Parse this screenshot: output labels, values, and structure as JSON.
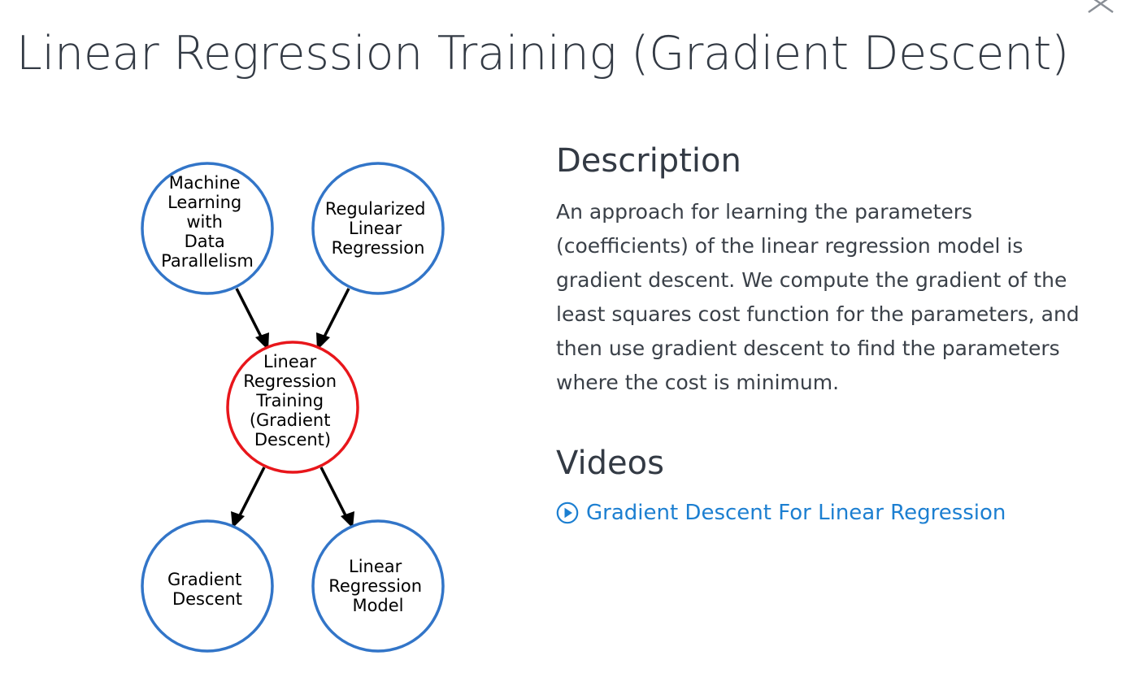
{
  "page": {
    "title": "Linear Regression Training (Gradient Descent)",
    "close_icon": "close-icon"
  },
  "graph": {
    "nodes": [
      {
        "id": "machine-learning-data-parallelism",
        "lines": [
          "Machine",
          "Learning",
          "with",
          "Data",
          "Parallelism"
        ],
        "state": "prerequisite"
      },
      {
        "id": "regularized-linear-regression",
        "lines": [
          "Regularized",
          "Linear",
          "Regression"
        ],
        "state": "prerequisite"
      },
      {
        "id": "linear-regression-training",
        "lines": [
          "Linear",
          "Regression",
          "Training",
          "(Gradient",
          "Descent)"
        ],
        "state": "current"
      },
      {
        "id": "gradient-descent",
        "lines": [
          "Gradient",
          "Descent"
        ],
        "state": "dependency"
      },
      {
        "id": "linear-regression-model",
        "lines": [
          "Linear",
          "Regression",
          "Model"
        ],
        "state": "dependency"
      }
    ],
    "colors": {
      "node_border": "#3275c8",
      "current_border": "#e8161b",
      "arrow": "#000000"
    }
  },
  "description": {
    "heading": "Description",
    "text": "An approach for learning the parameters (coefficients) of the linear regression model is gradient descent. We compute the gradient of the least squares cost function for the parameters, and then use gradient descent to find the parameters where the cost is minimum."
  },
  "videos": {
    "heading": "Videos",
    "items": [
      {
        "label": "Gradient Descent For Linear Regression",
        "icon": "play-circle-icon"
      }
    ],
    "link_color": "#1c7fd1"
  }
}
